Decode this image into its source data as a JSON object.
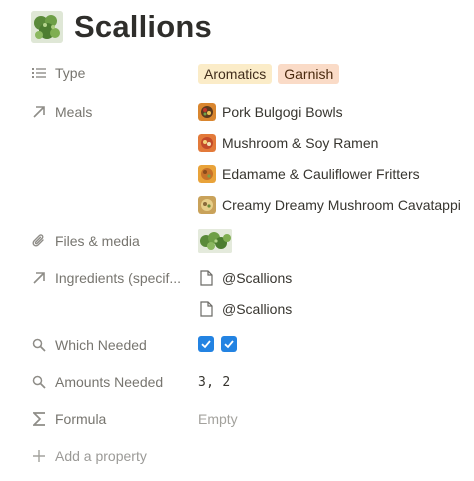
{
  "page": {
    "title": "Scallions",
    "icon": "scallion-photo-icon"
  },
  "properties": {
    "type": {
      "label": "Type",
      "icon": "list-icon",
      "tags": [
        {
          "label": "Aromatics",
          "color": "#fbecc8"
        },
        {
          "label": "Garnish",
          "color": "#fadbc7"
        }
      ]
    },
    "meals": {
      "label": "Meals",
      "icon": "arrow-up-right-icon",
      "items": [
        "Pork Bulgogi Bowls",
        "Mushroom & Soy Ramen",
        "Edamame & Cauliflower Fritters",
        "Creamy Dreamy Mushroom Cavatappi"
      ]
    },
    "files": {
      "label": "Files & media",
      "icon": "paperclip-icon"
    },
    "ingredients": {
      "label": "Ingredients (specif...",
      "icon": "arrow-up-right-icon",
      "items": [
        "@Scallions",
        "@Scallions"
      ]
    },
    "which_needed": {
      "label": "Which Needed",
      "icon": "search-icon",
      "checked": [
        true,
        true
      ]
    },
    "amounts_needed": {
      "label": "Amounts Needed",
      "icon": "search-icon",
      "value": "3, 2"
    },
    "formula": {
      "label": "Formula",
      "icon": "sigma-icon",
      "value": "Empty"
    },
    "add_property": {
      "label": "Add a property",
      "icon": "plus-icon"
    }
  },
  "colors": {
    "checkbox": "#2383e2",
    "label_text": "#77756f"
  }
}
